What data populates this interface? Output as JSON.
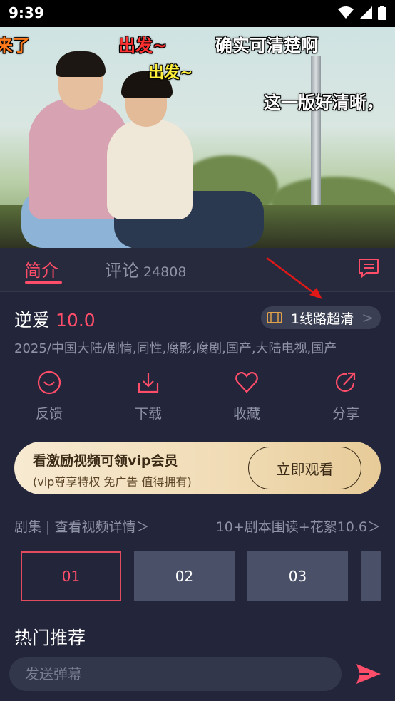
{
  "status_bar": {
    "time": "9:39"
  },
  "video": {
    "danmaku": [
      "来了",
      "出发~",
      "确实可清楚啊",
      "出发~",
      "这一版好清晰，"
    ]
  },
  "tabs": {
    "intro": "简介",
    "comments": "评论",
    "comments_count": "24808"
  },
  "show": {
    "title": "逆爱",
    "score": "10.0",
    "line_button": "1线路超清",
    "meta": "2025/中国大陆/剧情,同性,腐影,腐剧,国产,大陆电视,国产"
  },
  "actions": [
    {
      "label": "反馈",
      "icon": "feedback-icon"
    },
    {
      "label": "下载",
      "icon": "download-icon"
    },
    {
      "label": "收藏",
      "icon": "heart-icon"
    },
    {
      "label": "分享",
      "icon": "share-icon"
    }
  ],
  "vip_banner": {
    "title": "看激励视频可领vip会员",
    "subtitle": "(vip尊享特权 免广告 值得拥有)",
    "button": "立即观看"
  },
  "episodes": {
    "left_label": "剧集 | 查看视频详情＞",
    "right_label": "10+剧本围读+花絮10.6＞",
    "items": [
      "01",
      "02",
      "03"
    ]
  },
  "hot_section": {
    "title": "热门推荐"
  },
  "danmaku_input": {
    "placeholder": "发送弹幕"
  },
  "colors": {
    "accent": "#ff4d6a",
    "background": "#23263a",
    "tile": "#4a5068"
  }
}
